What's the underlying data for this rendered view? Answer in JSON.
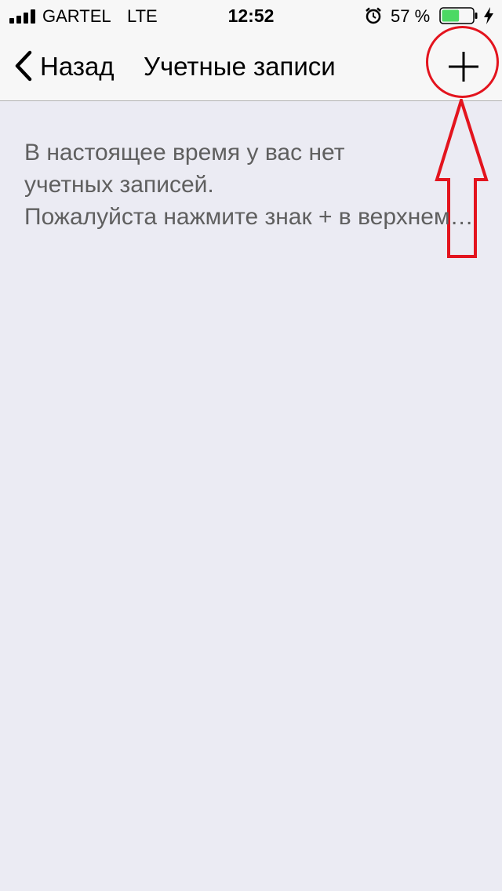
{
  "status_bar": {
    "carrier": "GARTEL",
    "network": "LTE",
    "time": "12:52",
    "battery_percent": "57 %",
    "battery_level": 0.57,
    "icons": [
      "signal-icon",
      "alarm-icon",
      "battery-icon",
      "charging-bolt-icon"
    ]
  },
  "nav_bar": {
    "back_label": "Назад",
    "title": "Учетные записи",
    "icons": [
      "back-chevron-icon",
      "plus-icon"
    ]
  },
  "content": {
    "line1": "В настоящее время у вас нет",
    "line2": "учетных записей.",
    "line3": "Пожалуйста нажмите знак + в верхнем правом углу"
  },
  "colors": {
    "background": "#ebebf3",
    "bar_background": "#f7f7f7",
    "annotation": "#e3141e",
    "battery_fill": "#4cd964",
    "message_text": "#5f5f5f"
  }
}
